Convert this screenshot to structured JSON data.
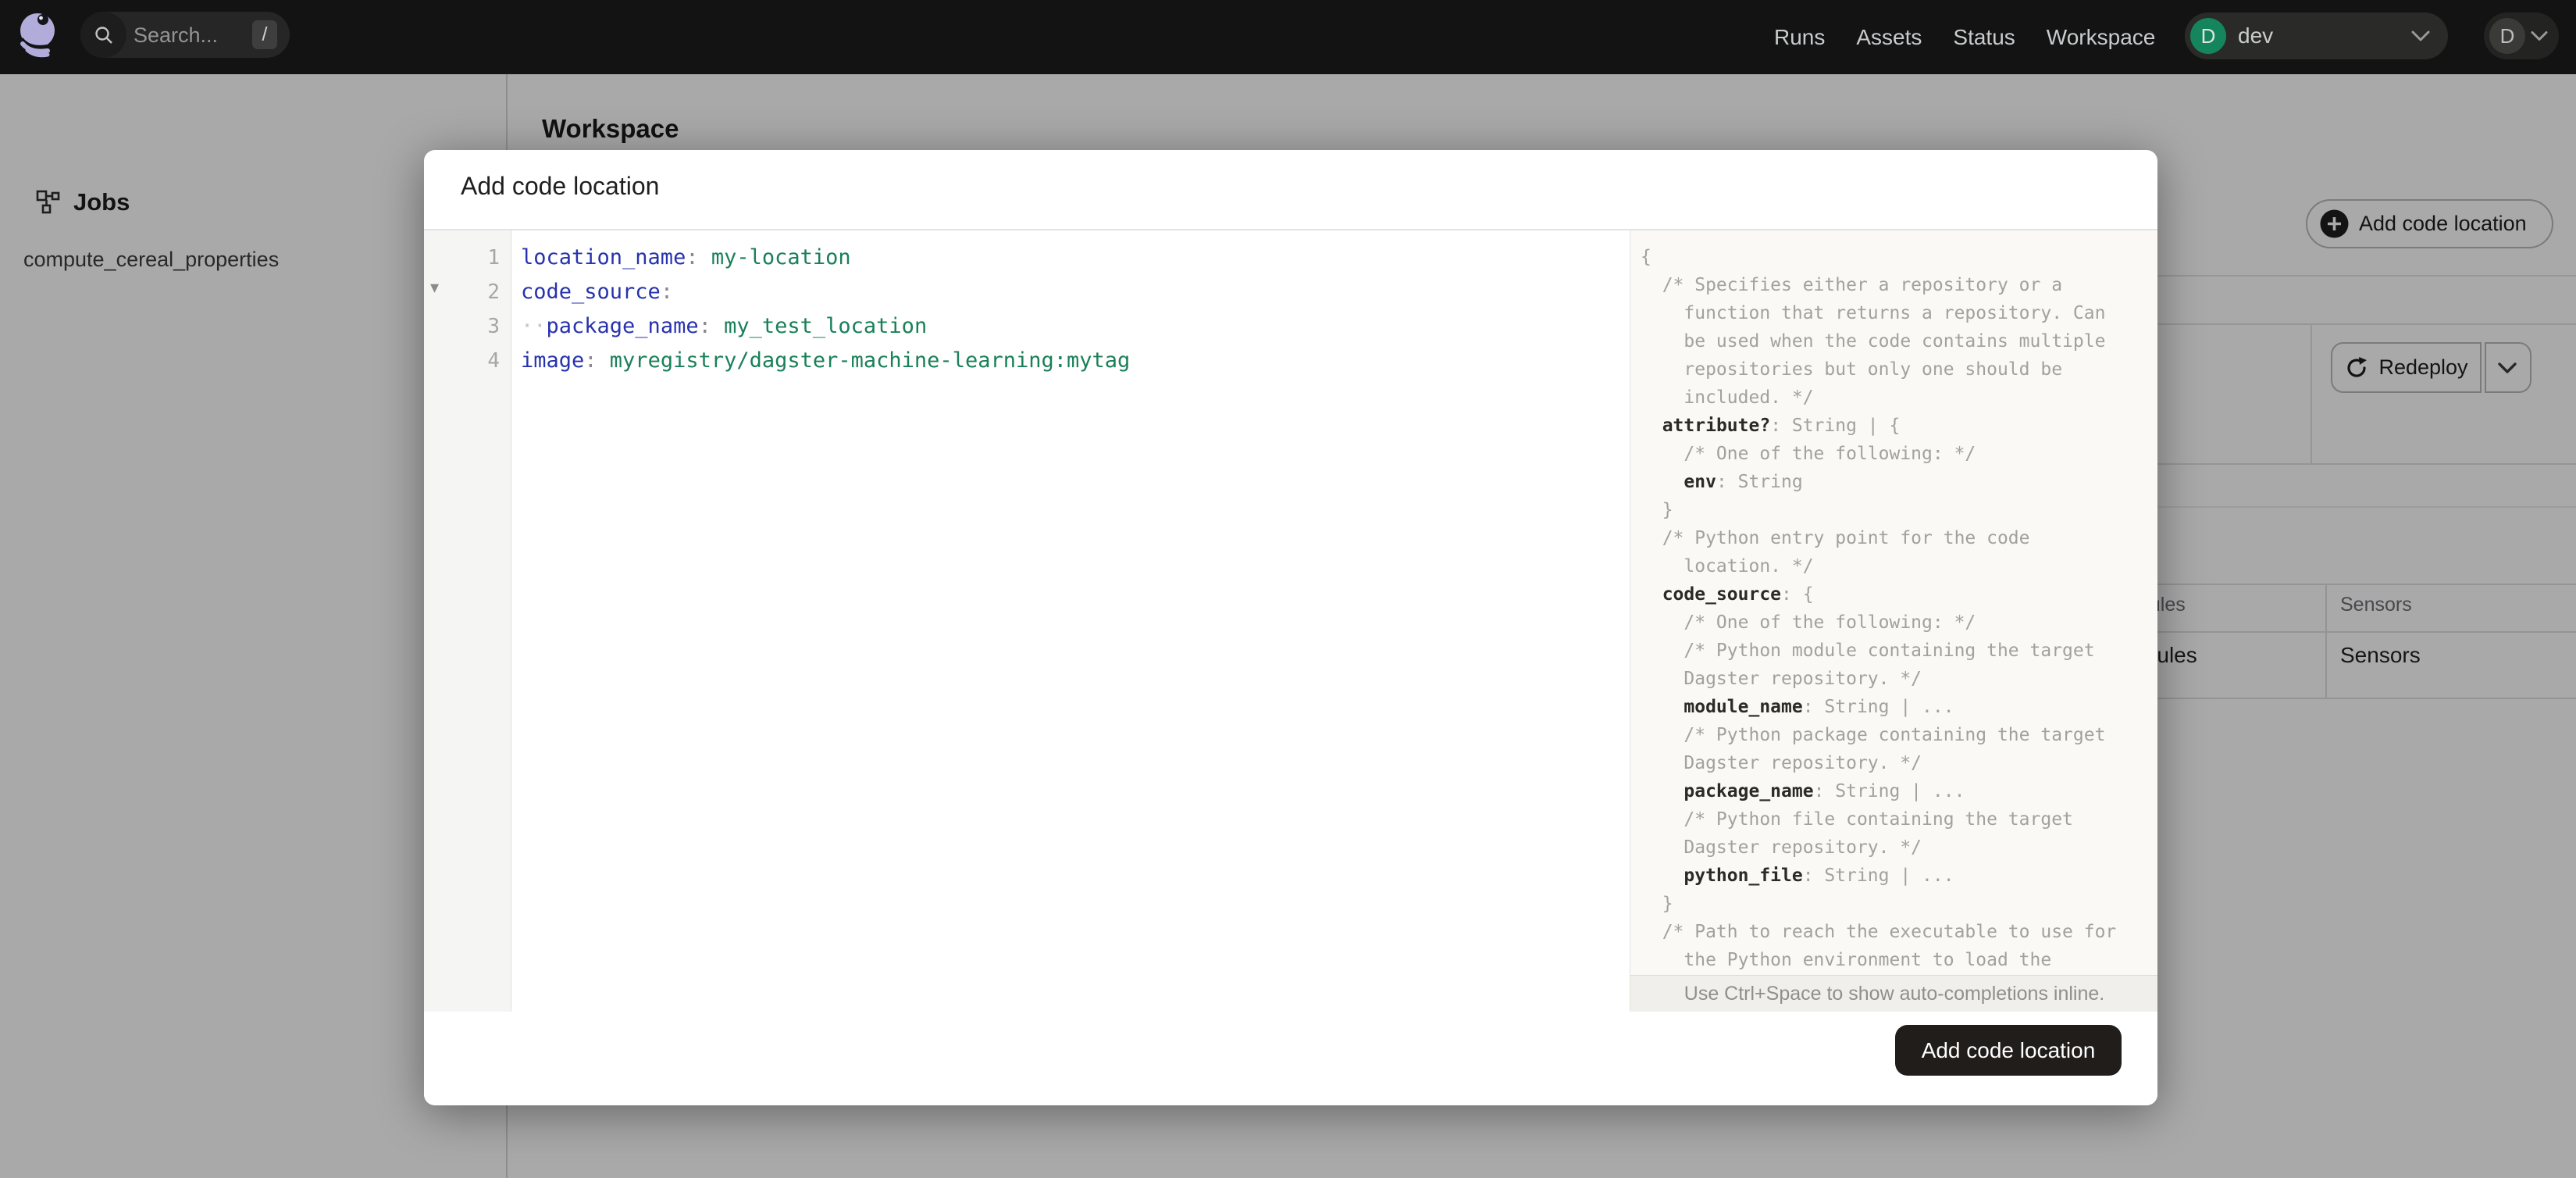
{
  "navbar": {
    "search": {
      "placeholder": "Search...",
      "shortcut": "/"
    },
    "links": [
      "Runs",
      "Assets",
      "Status",
      "Workspace"
    ],
    "deployment": {
      "avatar_letter": "D",
      "label": "dev"
    },
    "user": {
      "avatar_letter": "D"
    }
  },
  "sidebar": {
    "section_title": "Jobs",
    "items": [
      "compute_cereal_properties"
    ]
  },
  "workspace": {
    "title": "Workspace",
    "add_button_label": "Add code location",
    "redeploy_label": "Redeploy",
    "table": {
      "headers": [
        "Schedules",
        "Sensors"
      ],
      "row": [
        "Schedules",
        "Sensors"
      ]
    }
  },
  "modal": {
    "title": "Add code location",
    "submit_label": "Add code location",
    "editor": {
      "lines": [
        [
          {
            "t": "key",
            "s": "location_name"
          },
          {
            "t": "p",
            "s": ": "
          },
          {
            "t": "val",
            "s": "my-location"
          }
        ],
        [
          {
            "t": "key",
            "s": "code_source"
          },
          {
            "t": "p",
            "s": ":"
          }
        ],
        [
          {
            "t": "ws",
            "s": "··"
          },
          {
            "t": "key",
            "s": "package_name"
          },
          {
            "t": "p",
            "s": ": "
          },
          {
            "t": "val",
            "s": "my_test_location"
          }
        ],
        [
          {
            "t": "key",
            "s": "image"
          },
          {
            "t": "p",
            "s": ": "
          },
          {
            "t": "val",
            "s": "myregistry/dagster-machine-learning:mytag"
          }
        ]
      ]
    },
    "schema": {
      "lines": [
        [
          {
            "t": "c",
            "s": "{"
          }
        ],
        [
          {
            "t": "c",
            "s": "  /* Specifies either a repository or a"
          }
        ],
        [
          {
            "t": "c",
            "s": "    function that returns a repository. Can"
          }
        ],
        [
          {
            "t": "c",
            "s": "    be used when the code contains multiple"
          }
        ],
        [
          {
            "t": "c",
            "s": "    repositories but only one should be"
          }
        ],
        [
          {
            "t": "c",
            "s": "    included. */"
          }
        ],
        [
          {
            "t": "c",
            "s": "  "
          },
          {
            "t": "k",
            "s": "attribute?"
          },
          {
            "t": "c",
            "s": ": String | {"
          }
        ],
        [
          {
            "t": "c",
            "s": "    /* One of the following: */"
          }
        ],
        [
          {
            "t": "c",
            "s": "    "
          },
          {
            "t": "k",
            "s": "env"
          },
          {
            "t": "c",
            "s": ": String"
          }
        ],
        [
          {
            "t": "c",
            "s": "  }"
          }
        ],
        [
          {
            "t": "c",
            "s": "  /* Python entry point for the code"
          }
        ],
        [
          {
            "t": "c",
            "s": "    location. */"
          }
        ],
        [
          {
            "t": "c",
            "s": "  "
          },
          {
            "t": "k",
            "s": "code_source"
          },
          {
            "t": "c",
            "s": ": {"
          }
        ],
        [
          {
            "t": "c",
            "s": "    /* One of the following: */"
          }
        ],
        [
          {
            "t": "c",
            "s": "    /* Python module containing the target"
          }
        ],
        [
          {
            "t": "c",
            "s": "    Dagster repository. */"
          }
        ],
        [
          {
            "t": "c",
            "s": "    "
          },
          {
            "t": "k",
            "s": "module_name"
          },
          {
            "t": "c",
            "s": ": String | ..."
          }
        ],
        [
          {
            "t": "c",
            "s": "    /* Python package containing the target"
          }
        ],
        [
          {
            "t": "c",
            "s": "    Dagster repository. */"
          }
        ],
        [
          {
            "t": "c",
            "s": "    "
          },
          {
            "t": "k",
            "s": "package_name"
          },
          {
            "t": "c",
            "s": ": String | ..."
          }
        ],
        [
          {
            "t": "c",
            "s": "    /* Python file containing the target"
          }
        ],
        [
          {
            "t": "c",
            "s": "    Dagster repository. */"
          }
        ],
        [
          {
            "t": "c",
            "s": "    "
          },
          {
            "t": "k",
            "s": "python_file"
          },
          {
            "t": "c",
            "s": ": String | ..."
          }
        ],
        [
          {
            "t": "c",
            "s": "  }"
          }
        ],
        [
          {
            "t": "c",
            "s": "  /* Path to reach the executable to use for"
          }
        ],
        [
          {
            "t": "c",
            "s": "    the Python environment to load the"
          }
        ]
      ],
      "hint": "Use Ctrl+Space to show auto-completions inline."
    }
  },
  "colors": {
    "brand_lavender": "#b2acdb",
    "accent_green": "#15855d",
    "code_key": "#2733ad",
    "code_value": "#19805a",
    "modal_submit_bg": "#201d1b"
  }
}
